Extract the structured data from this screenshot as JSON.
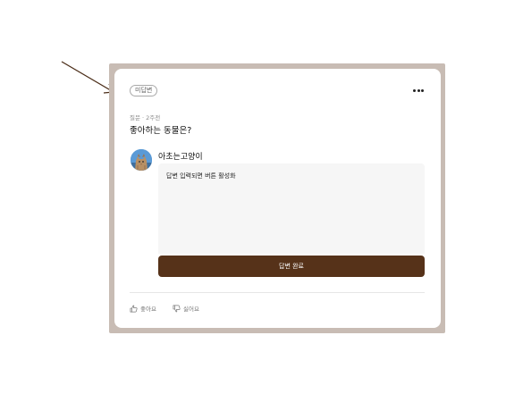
{
  "post": {
    "status_badge": "미답변",
    "meta": "질문 · 2주전",
    "question": "좋아하는 동물은?"
  },
  "answer": {
    "username": "아초는고양이",
    "input_value": "답변 입력되면 버튼 활성화",
    "submit_label": "답변 완료"
  },
  "reactions": {
    "like_label": "좋아요",
    "dislike_label": "싫어요"
  },
  "colors": {
    "frame": "#c8bcb4",
    "submit_button": "#563219",
    "answer_box": "#f6f6f6"
  },
  "icons": [
    "more-options-icon",
    "thumbs-up-icon",
    "thumbs-down-icon",
    "annotation-arrow"
  ]
}
